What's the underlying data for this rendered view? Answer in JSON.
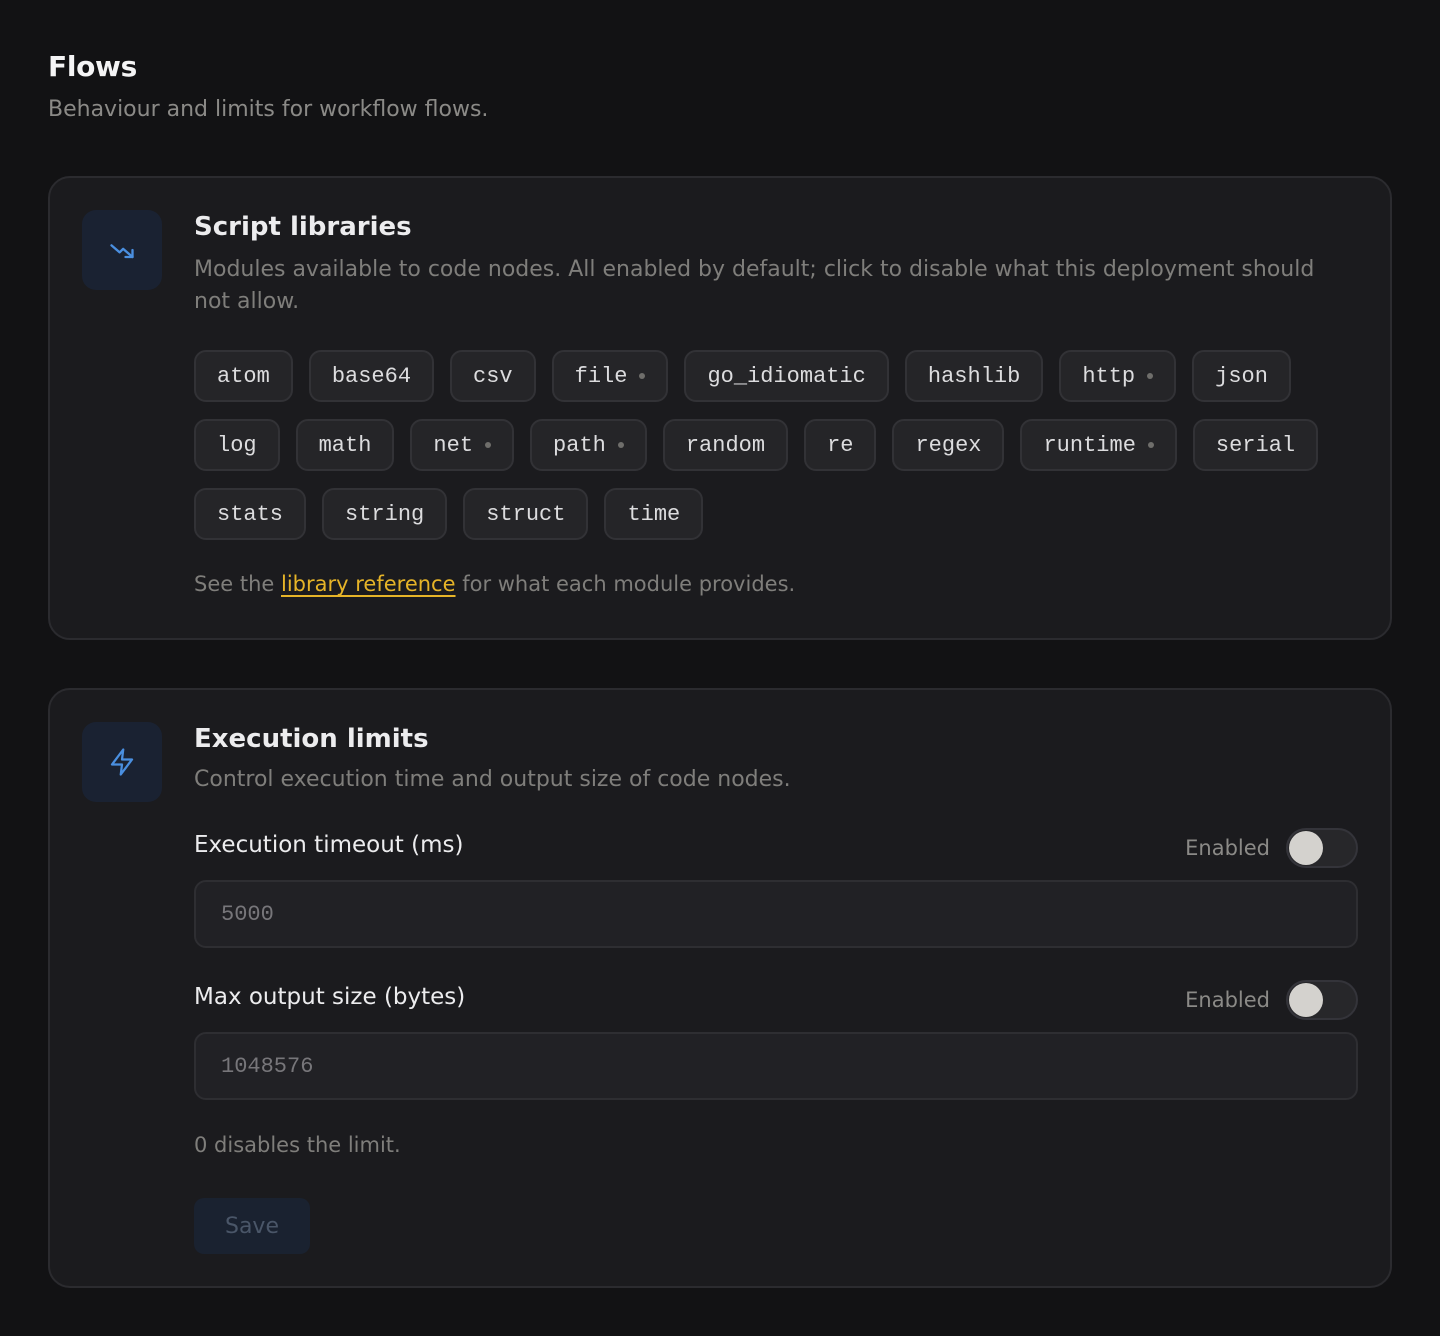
{
  "page": {
    "title": "Flows",
    "subtitle": "Behaviour and limits for workflow flows."
  },
  "script_libraries": {
    "icon": "trending-down-icon",
    "title": "Script libraries",
    "description": "Modules available to code nodes. All enabled by default; click to disable what this deployment should not allow.",
    "modules": [
      {
        "name": "atom",
        "dot": false
      },
      {
        "name": "base64",
        "dot": false
      },
      {
        "name": "csv",
        "dot": false
      },
      {
        "name": "file",
        "dot": true
      },
      {
        "name": "go_idiomatic",
        "dot": false
      },
      {
        "name": "hashlib",
        "dot": false
      },
      {
        "name": "http",
        "dot": true
      },
      {
        "name": "json",
        "dot": false
      },
      {
        "name": "log",
        "dot": false
      },
      {
        "name": "math",
        "dot": false
      },
      {
        "name": "net",
        "dot": true
      },
      {
        "name": "path",
        "dot": true
      },
      {
        "name": "random",
        "dot": false
      },
      {
        "name": "re",
        "dot": false
      },
      {
        "name": "regex",
        "dot": false
      },
      {
        "name": "runtime",
        "dot": true
      },
      {
        "name": "serial",
        "dot": false
      },
      {
        "name": "stats",
        "dot": false
      },
      {
        "name": "string",
        "dot": false
      },
      {
        "name": "struct",
        "dot": false
      },
      {
        "name": "time",
        "dot": false
      }
    ],
    "footnote_prefix": "See the",
    "footnote_link": "library reference",
    "footnote_suffix": "for what each module provides."
  },
  "execution_limits": {
    "icon": "lightning-icon",
    "title": "Execution limits",
    "description": "Control execution time and output size of code nodes.",
    "timeout": {
      "label": "Execution timeout (ms)",
      "toggle_label": "Enabled",
      "enabled": false,
      "placeholder": "5000"
    },
    "max_output": {
      "label": "Max output size (bytes)",
      "toggle_label": "Enabled",
      "enabled": false,
      "placeholder": "1048576"
    },
    "hint": "0 disables the limit.",
    "save_label": "Save"
  },
  "colors": {
    "accent": "#4a8fe0",
    "link": "#e6b428"
  }
}
